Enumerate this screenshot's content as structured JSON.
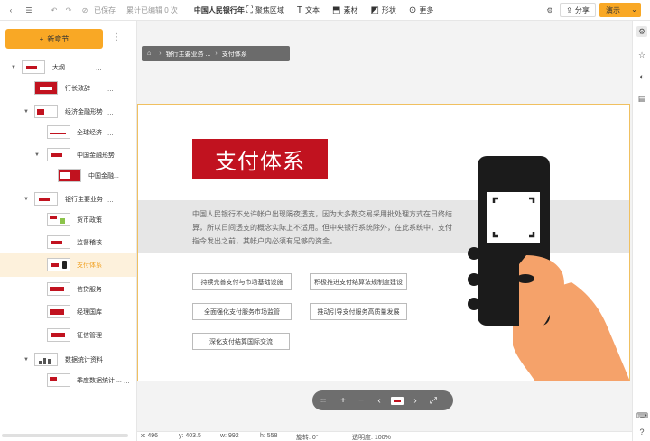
{
  "toolbar": {
    "saved": "已保存",
    "edit_count": "累计已编辑 0 次",
    "doc_title": "中国人民银行年",
    "items": [
      {
        "icon": "focus-area-icon",
        "label": "聚焦区域"
      },
      {
        "icon": "text-icon",
        "label": "文本"
      },
      {
        "icon": "asset-icon",
        "label": "素材"
      },
      {
        "icon": "shape-icon",
        "label": "形状"
      },
      {
        "icon": "more-icon",
        "label": "更多"
      }
    ],
    "share": "分享",
    "present": "演示"
  },
  "left_panel": {
    "new_section": "新章节",
    "tree": [
      {
        "label": "大纲",
        "level": 0,
        "caret": true
      },
      {
        "label": "行长致辞",
        "level": 1,
        "caret": false
      },
      {
        "label": "经济金融形势",
        "level": 1,
        "caret": true
      },
      {
        "label": "全球经济",
        "level": 2,
        "caret": false
      },
      {
        "label": "中国金融形势",
        "level": 2,
        "caret": true
      },
      {
        "label": "中国金融...",
        "level": 3,
        "caret": false
      },
      {
        "label": "银行主要业务",
        "level": 1,
        "caret": true
      },
      {
        "label": "货币政策",
        "level": 2,
        "caret": false
      },
      {
        "label": "监督稽核",
        "level": 2,
        "caret": false
      },
      {
        "label": "支付体系",
        "level": 2,
        "caret": false,
        "active": true
      },
      {
        "label": "信贷服务",
        "level": 2,
        "caret": false
      },
      {
        "label": "经理国库",
        "level": 2,
        "caret": false
      },
      {
        "label": "征信管理",
        "level": 2,
        "caret": false
      },
      {
        "label": "数据统计资料",
        "level": 1,
        "caret": true
      },
      {
        "label": "季度数据统计 ...",
        "level": 2,
        "caret": false
      }
    ],
    "more": "..."
  },
  "breadcrumb": {
    "items": [
      "银行主要业务 ...",
      "支付体系"
    ]
  },
  "slide": {
    "title": "支付体系",
    "paragraph": "中国人民银行不允许帐户出现隔夜透支，因为大多数交易采用批处理方式在日终结算，所以日间透支的概念实际上不适用。但中央银行系统除外，在此系统中，支付指令发出之前，其帐户内必须有足够的资金。",
    "pills": [
      "持续完善支付与市场基础设施",
      "积极推进支付结算法规制度建设",
      "全面强化支付服务市场监管",
      "推动引导支付服务高质量发展",
      "深化支付结算国际交流"
    ]
  },
  "float_bar": {
    "grip": ":::",
    "zoom_in": "+",
    "zoom_out": "−",
    "prev": "‹",
    "next": "›",
    "fit": "⤢"
  },
  "status": {
    "x": "x:  496",
    "y": "y:  403.5",
    "w": "w:  992",
    "h": "h:  558",
    "rotation": "旋转:  0°",
    "opacity": "透明度:  100%"
  },
  "colors": {
    "accent": "#f9a825",
    "brand_red": "#c1121f",
    "hand": "#f5a26a"
  }
}
